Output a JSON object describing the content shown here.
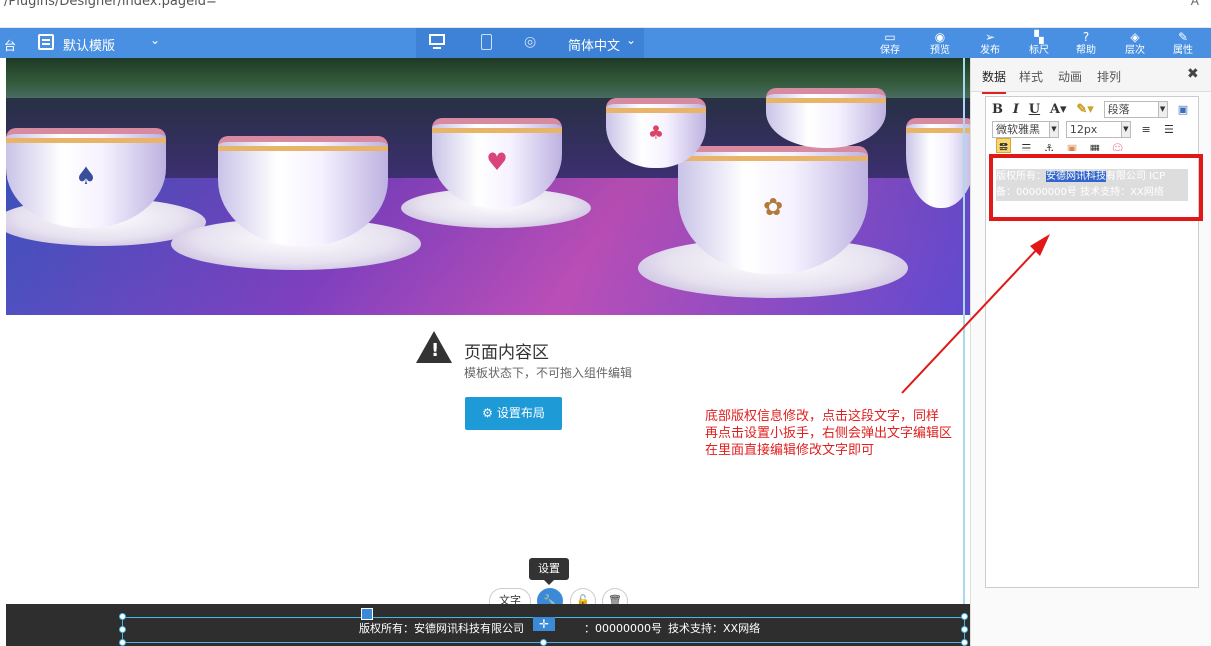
{
  "browser": {
    "url_fragment": "/Plugins/Designer/index.pageid=",
    "corner": "A"
  },
  "toolbar": {
    "left_stub": "台",
    "template_label": "默认模版",
    "language": "简体中文",
    "buttons": [
      {
        "icon": "save-icon",
        "label": "保存"
      },
      {
        "icon": "preview-icon",
        "label": "预览"
      },
      {
        "icon": "publish-icon",
        "label": "发布"
      },
      {
        "icon": "ruler-icon",
        "label": "标尺"
      },
      {
        "icon": "help-icon",
        "label": "帮助"
      },
      {
        "icon": "layers-icon",
        "label": "层次"
      },
      {
        "icon": "properties-icon",
        "label": "属性"
      }
    ],
    "accent": "#4a90e2"
  },
  "canvas": {
    "notice_title": "页面内容区",
    "notice_sub": "模板状态下，不可拖入组件编辑",
    "layout_button": "设置布局",
    "tooltip": "设置",
    "widget_text_button": "文字",
    "footer": {
      "copyright_prefix": "版权所有：",
      "company": "安德网讯科技有限公司",
      "icp_suffix": "：00000000号",
      "support": "技术支持：XX网络",
      "bg_color": "#2e2e2e"
    }
  },
  "annotation": {
    "lines": [
      "底部版权信息修改，点击这段文字，同样",
      "再点击设置小扳手，右侧会弹出文字编辑区",
      "在里面直接编辑修改文字即可"
    ],
    "color": "#e02020"
  },
  "panel": {
    "tabs": [
      "数据",
      "样式",
      "动画",
      "排列"
    ],
    "active_tab": "数据",
    "close": "✖",
    "editor": {
      "format_select": "段落",
      "font_select": "微软雅黑",
      "size_select": "12px",
      "content_prefix": "版权所有：",
      "content_selected": "安德网讯科技",
      "content_suffix": "有限公司    ICP",
      "content_line2": "备：00000000号    技术支持：XX网络"
    }
  }
}
